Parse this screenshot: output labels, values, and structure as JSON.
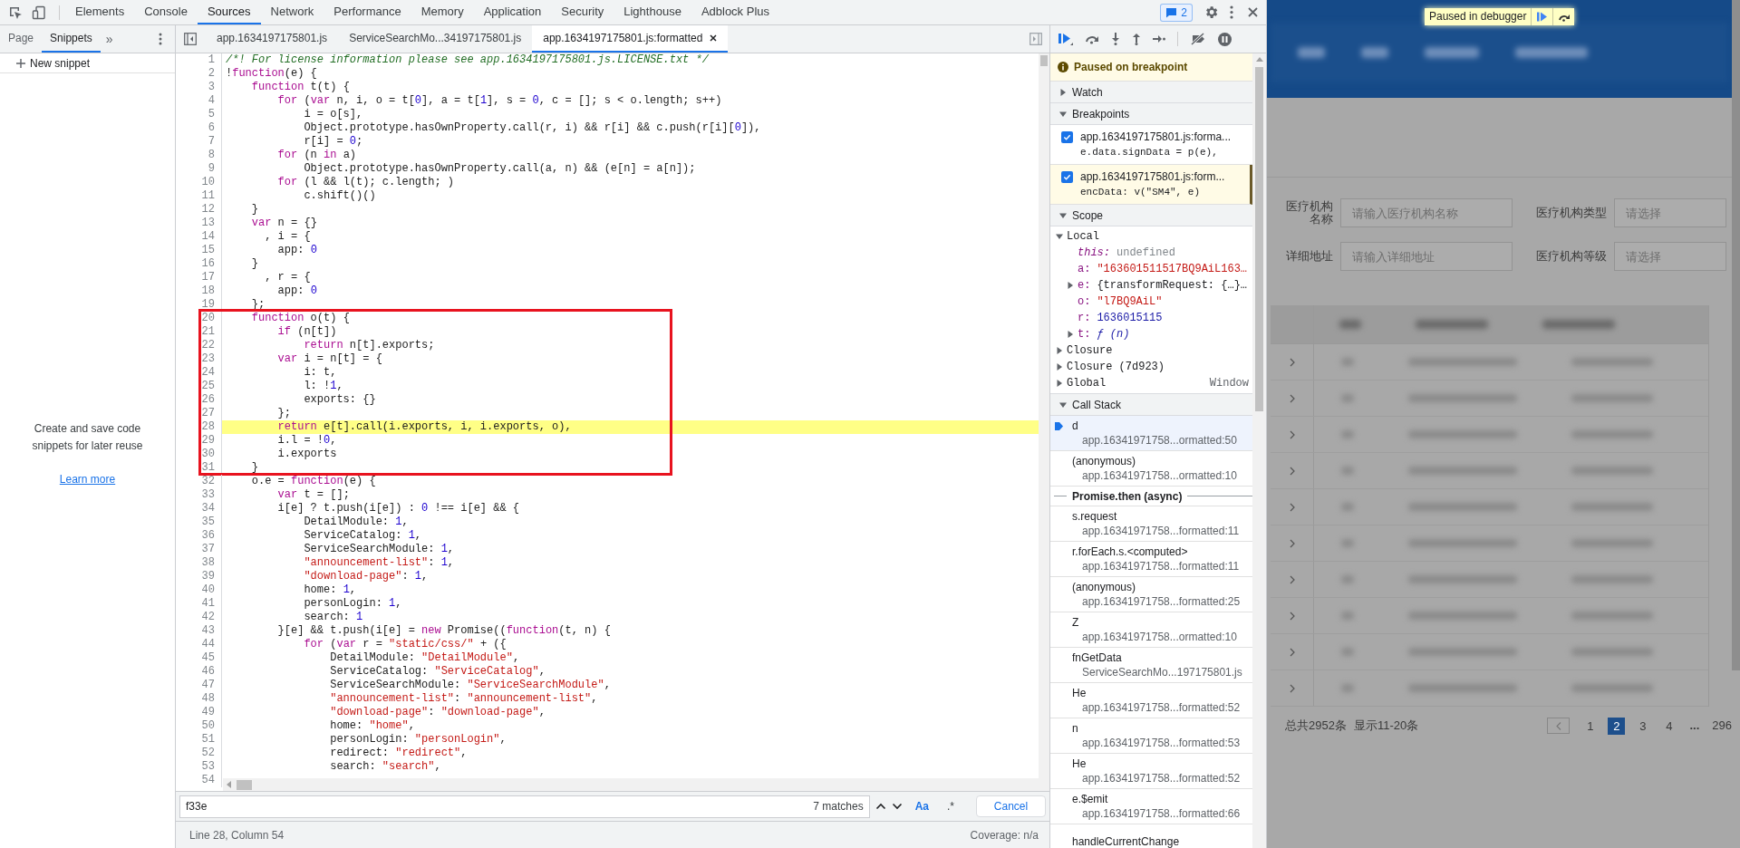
{
  "devtools": {
    "tabs": [
      {
        "label": "Elements",
        "selected": false
      },
      {
        "label": "Console",
        "selected": false
      },
      {
        "label": "Sources",
        "selected": true
      },
      {
        "label": "Network",
        "selected": false
      },
      {
        "label": "Performance",
        "selected": false
      },
      {
        "label": "Memory",
        "selected": false
      },
      {
        "label": "Application",
        "selected": false
      },
      {
        "label": "Security",
        "selected": false
      },
      {
        "label": "Lighthouse",
        "selected": false
      },
      {
        "label": "Adblock Plus",
        "selected": false
      }
    ],
    "issues_badge": "2"
  },
  "navigator": {
    "tabs": [
      {
        "label": "Page",
        "selected": false
      },
      {
        "label": "Snippets",
        "selected": true
      }
    ],
    "more": "»",
    "new_snippet": "New snippet",
    "empty_text": "Create and save code snippets for later reuse",
    "link": "Learn more"
  },
  "editor": {
    "tabs": [
      {
        "label": "app.1634197175801.js",
        "selected": false,
        "closable": false
      },
      {
        "label": "ServiceSearchMo...34197175801.js",
        "selected": false,
        "closable": false
      },
      {
        "label": "app.1634197175801.js:formatted",
        "selected": true,
        "closable": true
      }
    ],
    "blocks": [
      {
        "boxed": false,
        "lines": [
          {
            "n": "1",
            "code": "/*! For license information please see app.1634197175801.js.LICENSE.txt */"
          },
          {
            "n": "2",
            "code": "!function(e) {"
          },
          {
            "n": "3",
            "code": "    function t(t) {"
          },
          {
            "n": "4",
            "code": "        for (var n, i, o = t[0], a = t[1], s = 0, c = []; s < o.length; s++)"
          },
          {
            "n": "5",
            "code": "            i = o[s],"
          },
          {
            "n": "6",
            "code": "            Object.prototype.hasOwnProperty.call(r, i) && r[i] && c.push(r[i][0]),"
          },
          {
            "n": "7",
            "code": "            r[i] = 0;"
          },
          {
            "n": "8",
            "code": "        for (n in a)"
          },
          {
            "n": "9",
            "code": "            Object.prototype.hasOwnProperty.call(a, n) && (e[n] = a[n]);"
          },
          {
            "n": "10",
            "code": "        for (l && l(t); c.length; )"
          },
          {
            "n": "11",
            "code": "            c.shift()()"
          },
          {
            "n": "12",
            "code": "    }"
          },
          {
            "n": "13",
            "code": "    var n = {}"
          },
          {
            "n": "14",
            "code": "      , i = {"
          },
          {
            "n": "15",
            "code": "        app: 0"
          },
          {
            "n": "16",
            "code": "    }"
          },
          {
            "n": "17",
            "code": "      , r = {"
          },
          {
            "n": "18",
            "code": "        app: 0"
          },
          {
            "n": "19",
            "code": "    };"
          }
        ]
      },
      {
        "boxed": true,
        "lines": [
          {
            "n": "20",
            "code": "    function o(t) {"
          },
          {
            "n": "21",
            "code": "        if (n[t])"
          },
          {
            "n": "22",
            "code": "            return n[t].exports;"
          },
          {
            "n": "23",
            "code": "        var i = n[t] = {"
          },
          {
            "n": "24",
            "code": "            i: t,"
          },
          {
            "n": "25",
            "code": "            l: !1,"
          },
          {
            "n": "26",
            "code": "            exports: {}"
          },
          {
            "n": "27",
            "code": "        };"
          },
          {
            "n": "28",
            "code": "        return e[t].call(i.exports, i, i.exports, o),",
            "current": true
          },
          {
            "n": "29",
            "code": "        i.l = !0,"
          },
          {
            "n": "30",
            "code": "        i.exports"
          },
          {
            "n": "31",
            "code": "    }"
          }
        ]
      },
      {
        "boxed": false,
        "lines": [
          {
            "n": "32",
            "code": "    o.e = function(e) {"
          },
          {
            "n": "33",
            "code": "        var t = [];"
          },
          {
            "n": "34",
            "code": "        i[e] ? t.push(i[e]) : 0 !== i[e] && {"
          },
          {
            "n": "35",
            "code": "            DetailModule: 1,"
          },
          {
            "n": "36",
            "code": "            ServiceCatalog: 1,"
          },
          {
            "n": "37",
            "code": "            ServiceSearchModule: 1,"
          },
          {
            "n": "38",
            "code": "            \"announcement-list\": 1,"
          },
          {
            "n": "39",
            "code": "            \"download-page\": 1,"
          },
          {
            "n": "40",
            "code": "            home: 1,"
          },
          {
            "n": "41",
            "code": "            personLogin: 1,"
          },
          {
            "n": "42",
            "code": "            search: 1"
          },
          {
            "n": "43",
            "code": "        }[e] && t.push(i[e] = new Promise((function(t, n) {"
          },
          {
            "n": "44",
            "code": "            for (var r = \"static/css/\" + ({"
          },
          {
            "n": "45",
            "code": "                DetailModule: \"DetailModule\","
          },
          {
            "n": "46",
            "code": "                ServiceCatalog: \"ServiceCatalog\","
          },
          {
            "n": "47",
            "code": "                ServiceSearchModule: \"ServiceSearchModule\","
          },
          {
            "n": "48",
            "code": "                \"announcement-list\": \"announcement-list\","
          },
          {
            "n": "49",
            "code": "                \"download-page\": \"download-page\","
          },
          {
            "n": "50",
            "code": "                home: \"home\","
          },
          {
            "n": "51",
            "code": "                personLogin: \"personLogin\","
          },
          {
            "n": "52",
            "code": "                redirect: \"redirect\","
          },
          {
            "n": "53",
            "code": "                search: \"search\","
          },
          {
            "n": "54"
          }
        ]
      }
    ],
    "search": {
      "query": "f33e",
      "matches": "7 matches",
      "case_toggle": "Aa",
      "regex_toggle": ".*",
      "cancel": "Cancel"
    },
    "status": {
      "position": "Line 28, Column 54",
      "coverage": "Coverage: n/a"
    }
  },
  "debugger": {
    "banner": "Paused on breakpoint",
    "watch": {
      "title": "Watch",
      "expanded": false
    },
    "breakpoints": {
      "title": "Breakpoints",
      "expanded": true,
      "items": [
        {
          "file": "app.1634197175801.js:forma...",
          "code": "e.data.signData = p(e),",
          "checked": true,
          "selected": false
        },
        {
          "file": "app.1634197175801.js:form...",
          "code": "encData: v(\"SM4\", e)",
          "checked": true,
          "selected": true
        }
      ]
    },
    "scope": {
      "title": "Scope",
      "expanded": true,
      "groups": [
        {
          "name": "Local",
          "expanded": true,
          "children": [
            {
              "name": "this:",
              "value": "undefined",
              "kind": "undefined",
              "expandable": false
            },
            {
              "name": "a:",
              "value": "\"163601511517BQ9AiL163…",
              "kind": "string",
              "expandable": false
            },
            {
              "name": "e:",
              "value": "{transformRequest: {…}…",
              "kind": "object",
              "expandable": true
            },
            {
              "name": "o:",
              "value": "\"l7BQ9AiL\"",
              "kind": "string",
              "expandable": false
            },
            {
              "name": "r:",
              "value": "1636015115",
              "kind": "number",
              "expandable": false
            },
            {
              "name": "t:",
              "value": "ƒ (n)",
              "kind": "function",
              "expandable": true
            }
          ]
        },
        {
          "name": "Closure",
          "expanded": false
        },
        {
          "name": "Closure (7d923)",
          "expanded": false
        },
        {
          "name": "Global",
          "expanded": false,
          "value": "Window"
        }
      ]
    },
    "call_stack": {
      "title": "Call Stack",
      "expanded": true,
      "frames": [
        {
          "kind": "frame",
          "name": "d",
          "location": "app.16341971758...ormatted:50",
          "selected": true
        },
        {
          "kind": "frame",
          "name": "(anonymous)",
          "location": "app.16341971758...ormatted:10",
          "selected": false
        },
        {
          "kind": "async",
          "name": "Promise.then (async)"
        },
        {
          "kind": "frame",
          "name": "s.request",
          "location": "app.16341971758...formatted:11",
          "selected": false
        },
        {
          "kind": "frame",
          "name": "r.forEach.s.<computed>",
          "location": "app.16341971758...formatted:11",
          "selected": false
        },
        {
          "kind": "frame",
          "name": "(anonymous)",
          "location": "app.16341971758...formatted:25",
          "selected": false
        },
        {
          "kind": "frame",
          "name": "Z",
          "location": "app.16341971758...ormatted:10",
          "selected": false
        },
        {
          "kind": "frame",
          "name": "fnGetData",
          "location": "ServiceSearchMo...197175801.js",
          "selected": false
        },
        {
          "kind": "frame",
          "name": "He",
          "location": "app.16341971758...formatted:52",
          "selected": false
        },
        {
          "kind": "frame",
          "name": "n",
          "location": "app.16341971758...formatted:53",
          "selected": false
        },
        {
          "kind": "frame",
          "name": "He",
          "location": "app.16341971758...formatted:52",
          "selected": false
        },
        {
          "kind": "frame",
          "name": "e.$emit",
          "location": "app.16341971758...formatted:66",
          "selected": false
        },
        {
          "kind": "frame",
          "name": "handleCurrentChange",
          "selected": false
        }
      ]
    }
  },
  "page": {
    "paused_label": "Paused in debugger",
    "fields": [
      {
        "label": "医疗机构名称",
        "placeholder": "请输入医疗机构名称"
      },
      {
        "label": "医疗机构类型",
        "placeholder": "请选择"
      },
      {
        "label": "详细地址",
        "placeholder": "请输入详细地址"
      },
      {
        "label": "医疗机构等级",
        "placeholder": "请选择"
      }
    ],
    "table": {
      "rows": [
        {
          "expanded": false
        },
        {
          "expanded": false
        },
        {
          "expanded": false
        },
        {
          "expanded": false
        },
        {
          "expanded": false
        },
        {
          "expanded": false
        },
        {
          "expanded": false
        },
        {
          "expanded": false
        },
        {
          "expanded": false
        },
        {
          "expanded": false
        }
      ]
    },
    "pagination": {
      "total": "总共2952条",
      "range": "显示11-20条",
      "pages": [
        {
          "label": "1",
          "selected": false
        },
        {
          "label": "2",
          "selected": true
        },
        {
          "label": "3",
          "selected": false
        },
        {
          "label": "4",
          "selected": false
        }
      ],
      "ellipsis": "...",
      "last": "296"
    }
  }
}
